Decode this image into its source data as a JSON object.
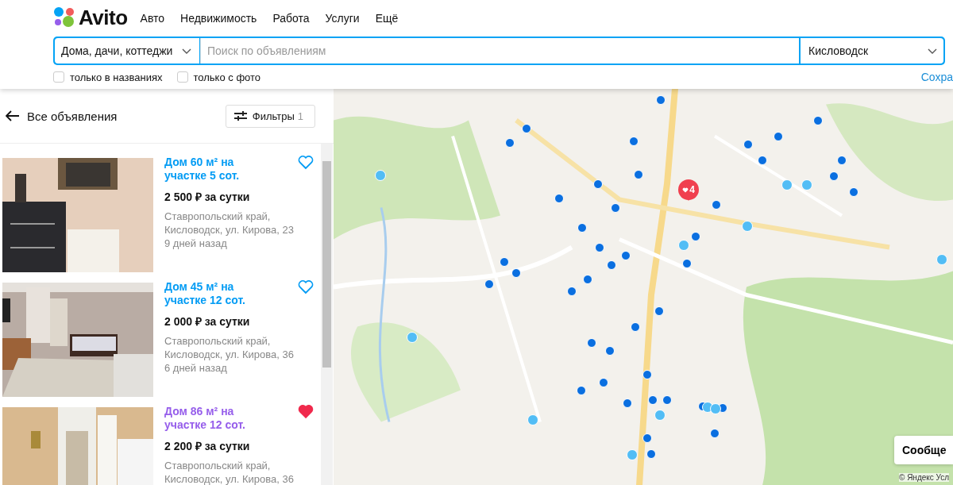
{
  "header": {
    "logo": "Avito",
    "nav": [
      "Авто",
      "Недвижимость",
      "Работа",
      "Услуги",
      "Ещё"
    ]
  },
  "search": {
    "category": "Дома, дачи, коттеджи",
    "placeholder": "Поиск по объявлениям",
    "city": "Кисловодск"
  },
  "options": [
    {
      "label": "только в названиях",
      "checked": false
    },
    {
      "label": "только с фото",
      "checked": false
    }
  ],
  "save_link": "Сохра",
  "sidebar": {
    "back": "Все объявления",
    "filters": {
      "label": "Фильтры",
      "count": "1"
    }
  },
  "listings": [
    {
      "title": "Дом 60 м² на участке 5 сот.",
      "price": "2 500 ₽ за сутки",
      "address": "Ставропольский край, Кисловодск, ул. Кирова, 23",
      "date": "9 дней назад",
      "visited": false,
      "favorite": false
    },
    {
      "title": "Дом 45 м² на участке 12 сот.",
      "price": "2 000 ₽ за сутки",
      "address": "Ставропольский край, Кисловодск, ул. Кирова, 36",
      "date": "6 дней назад",
      "visited": false,
      "favorite": false
    },
    {
      "title": "Дом 86 м² на участке 12 сот.",
      "price": "2 200 ₽ за сутки",
      "address": "Ставропольский край, Кисловодск, ул. Кирова, 36",
      "visited": true,
      "favorite": true
    }
  ],
  "map": {
    "kind": "picture",
    "pin_count": "4",
    "message_button": "Сообще",
    "copyright": "© Яндекс Усл"
  }
}
